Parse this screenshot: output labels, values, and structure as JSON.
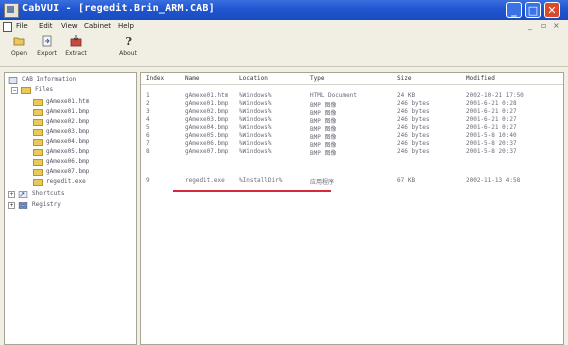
{
  "window": {
    "title": "CabVUI - [regedit.Brin_ARM.CAB]",
    "buttons": {
      "minimize": "_",
      "maximize": "□",
      "close": "✕"
    }
  },
  "menubar": {
    "items": [
      "File",
      "Edit",
      "View",
      "Cabinet",
      "Help"
    ],
    "mdi_controls": [
      "_",
      "▫",
      "×"
    ]
  },
  "toolbar": {
    "buttons": [
      {
        "label": "Open",
        "icon": "open-folder-icon"
      },
      {
        "label": "Export",
        "icon": "export-icon"
      },
      {
        "label": "Extract",
        "icon": "extract-icon"
      },
      {
        "label": "About",
        "icon": "about-icon"
      }
    ]
  },
  "tree": {
    "root": "CAB Information",
    "files_label": "Files",
    "files": [
      "gAmexe01.htm",
      "gAmexe01.bmp",
      "gAmexe02.bmp",
      "gAmexe03.bmp",
      "gAmexe04.bmp",
      "gAmexe05.bmp",
      "gAmexe06.bmp",
      "gAmexe07.bmp",
      "regedit.exe"
    ],
    "shortcuts": "Shortcuts",
    "registry": "Registry"
  },
  "list": {
    "columns": [
      "Index",
      "Name",
      "Location",
      "Type",
      "Size",
      "Modified"
    ],
    "rows": [
      {
        "index": "1",
        "name": "gAmexe01.htm",
        "location": "%Windows%",
        "type": "HTML Document",
        "size": "24 KB",
        "modified": "2002-10-21 17:50"
      },
      {
        "index": "2",
        "name": "gAmexe01.bmp",
        "location": "%Windows%",
        "type": "BMP 图像",
        "size": "246 bytes",
        "modified": "2001-6-21 0:28"
      },
      {
        "index": "3",
        "name": "gAmexe02.bmp",
        "location": "%Windows%",
        "type": "BMP 图像",
        "size": "246 bytes",
        "modified": "2001-6-21 0:27"
      },
      {
        "index": "4",
        "name": "gAmexe03.bmp",
        "location": "%Windows%",
        "type": "BMP 图像",
        "size": "246 bytes",
        "modified": "2001-6-21 0:27"
      },
      {
        "index": "5",
        "name": "gAmexe04.bmp",
        "location": "%Windows%",
        "type": "BMP 图像",
        "size": "246 bytes",
        "modified": "2001-6-21 0:27"
      },
      {
        "index": "6",
        "name": "gAmexe05.bmp",
        "location": "%Windows%",
        "type": "BMP 图像",
        "size": "246 bytes",
        "modified": "2001-5-8 10:40"
      },
      {
        "index": "7",
        "name": "gAmexe06.bmp",
        "location": "%Windows%",
        "type": "BMP 图像",
        "size": "246 bytes",
        "modified": "2001-5-8 20:37"
      },
      {
        "index": "8",
        "name": "gAmexe07.bmp",
        "location": "%Windows%",
        "type": "BMP 图像",
        "size": "246 bytes",
        "modified": "2001-5-8 20:37"
      },
      {
        "index": "9",
        "name": "regedit.exe",
        "location": "%InstallDir%",
        "type": "应用程序",
        "size": "67 KB",
        "modified": "2002-11-13 4:58"
      }
    ]
  },
  "colors": {
    "titlebar": "#1f55cf",
    "highlight_underline": "#d8283a",
    "folder": "#e9c95a"
  }
}
